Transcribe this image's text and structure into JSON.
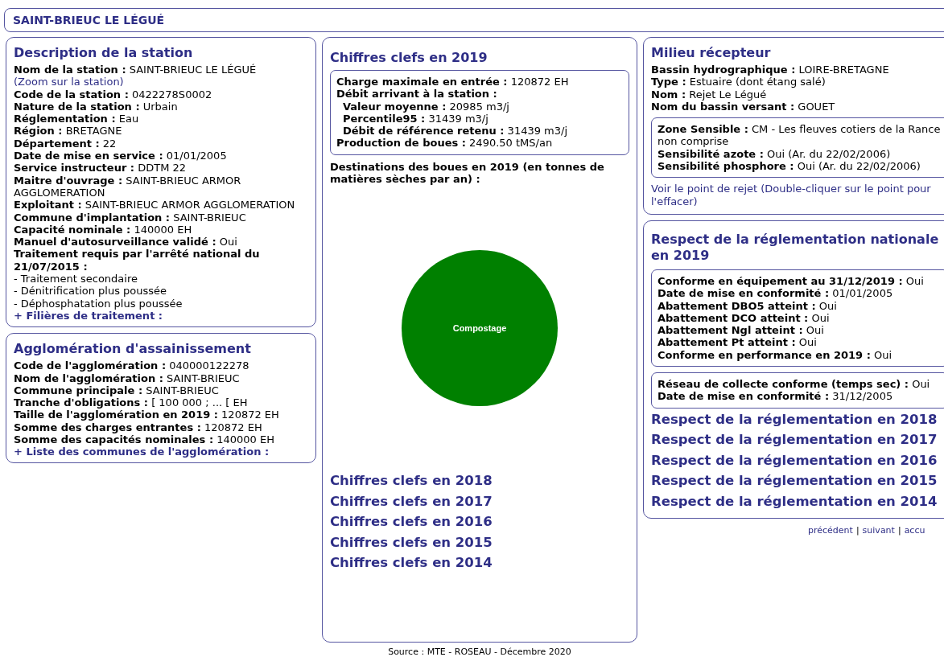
{
  "page_title": "SAINT-BRIEUC LE LÉGUÉ",
  "description": {
    "title": "Description de la station",
    "fields": [
      {
        "label": "Nom de la station :",
        "value": "SAINT-BRIEUC LE LÉGUÉ",
        "link": "(Zoom sur la station)"
      },
      {
        "label": "Code de la station :",
        "value": "0422278S0002"
      },
      {
        "label": "Nature de la station :",
        "value": "Urbain"
      },
      {
        "label": "Réglementation :",
        "value": "Eau"
      },
      {
        "label": "Région :",
        "value": "BRETAGNE"
      },
      {
        "label": "Département :",
        "value": "22"
      },
      {
        "label": "Date de mise en service :",
        "value": "01/01/2005"
      },
      {
        "label": "Service instructeur :",
        "value": "DDTM 22"
      },
      {
        "label": "Maitre d'ouvrage :",
        "value": "SAINT-BRIEUC ARMOR AGGLOMERATION"
      },
      {
        "label": "Exploitant :",
        "value": "SAINT-BRIEUC ARMOR AGGLOMERATION"
      },
      {
        "label": "Commune d'implantation :",
        "value": "SAINT-BRIEUC"
      },
      {
        "label": "Capacité nominale :",
        "value": "140000 EH"
      },
      {
        "label": "Manuel d'autosurveillance validé :",
        "value": "Oui"
      },
      {
        "label": "Traitement requis par l'arrêté national du 21/07/2015  :"
      }
    ],
    "treatments": [
      "- Traitement secondaire",
      "- Dénitrification plus poussée",
      "- Déphosphatation plus poussée"
    ],
    "toggle": "+ Filières de traitement :"
  },
  "agglomeration": {
    "title": "Agglomération d'assainissement",
    "fields": [
      {
        "label": "Code de l'agglomération :",
        "value": "040000122278"
      },
      {
        "label": "Nom de l'agglomération :",
        "value": "SAINT-BRIEUC"
      },
      {
        "label": "Commune principale :",
        "value": "SAINT-BRIEUC"
      },
      {
        "label": "Tranche d'obligations :",
        "value": "[ 100 000 ; ... [ EH"
      },
      {
        "label": "Taille de l'agglomération en 2019 :",
        "value": "120872 EH"
      },
      {
        "label": "Somme des charges entrantes :",
        "value": "120872 EH"
      },
      {
        "label": "Somme des capacités nominales :",
        "value": "140000 EH"
      }
    ],
    "toggle": "+ Liste des communes de l'agglomération :"
  },
  "key_figures": {
    "title": "Chiffres clefs en 2019",
    "fields": [
      {
        "label": "Charge maximale en entrée  :",
        "value": "120872 EH"
      },
      {
        "label": "Débit arrivant à la station :",
        "children": [
          {
            "label": "Valeur moyenne :",
            "value": "20985 m3/j"
          },
          {
            "label": "Percentile95 :",
            "value": "31439 m3/j"
          },
          {
            "label": "Débit de référence retenu :",
            "value": "31439 m3/j"
          }
        ]
      },
      {
        "label": "Production de boues :",
        "value": "2490.50 tMS/an"
      }
    ],
    "sludge_title": "Destinations des boues en 2019 (en tonnes de matières sèches par an) :",
    "chart_data": {
      "type": "pie",
      "categories": [
        "Compostage"
      ]
    },
    "other_years": [
      "Chiffres clefs en 2018",
      "Chiffres clefs en 2017",
      "Chiffres clefs en 2016",
      "Chiffres clefs en 2015",
      "Chiffres clefs en 2014"
    ]
  },
  "receiving": {
    "title": "Milieu récepteur",
    "fields": [
      {
        "label": "Bassin hydrographique :",
        "value": "LOIRE-BRETAGNE"
      },
      {
        "label": "Type :",
        "value": "Estuaire (dont étang salé)"
      },
      {
        "label": "Nom :",
        "value": "Rejet Le Légué"
      },
      {
        "label": "Nom du bassin versant :",
        "value": "GOUET"
      }
    ],
    "sensitive": [
      {
        "label": "Zone Sensible :",
        "value": "CM - Les fleuves cotiers de la Rance non comprise"
      },
      {
        "label": "Sensibilité azote :",
        "value": "Oui (Ar. du 22/02/2006)"
      },
      {
        "label": "Sensibilité phosphore :",
        "value": "Oui (Ar. du 22/02/2006)"
      }
    ],
    "link": "Voir le point de rejet (Double-cliquer sur le point pour l'effacer)"
  },
  "compliance": {
    "title": "Respect de la réglementation nationale en 2019",
    "groups": [
      [
        {
          "label": "Conforme en équipement au 31/12/2019 :",
          "value": "Oui"
        },
        {
          "label": "Date de mise en conformité :",
          "value": "01/01/2005"
        },
        {
          "label": "Abattement DBO5 atteint :",
          "value": "Oui"
        },
        {
          "label": "Abattement DCO atteint :",
          "value": "Oui"
        },
        {
          "label": "Abattement Ngl atteint :",
          "value": "Oui"
        },
        {
          "label": "Abattement Pt atteint :",
          "value": "Oui"
        },
        {
          "label": "Conforme en performance en 2019 :",
          "value": "Oui"
        }
      ],
      [
        {
          "label": "Réseau de collecte conforme (temps sec) :",
          "value": "Oui"
        },
        {
          "label": "Date de mise en conformité :",
          "value": "31/12/2005"
        }
      ]
    ],
    "other_years": [
      "Respect de la réglementation en 2018",
      "Respect de la réglementation en 2017",
      "Respect de la réglementation en 2016",
      "Respect de la réglementation en 2015",
      "Respect de la réglementation en 2014"
    ]
  },
  "nav": {
    "links": [
      "précédent",
      "suivant",
      "accu"
    ],
    "separator": "|"
  },
  "source": "Source : MTE - ROSEAU - Décembre 2020"
}
